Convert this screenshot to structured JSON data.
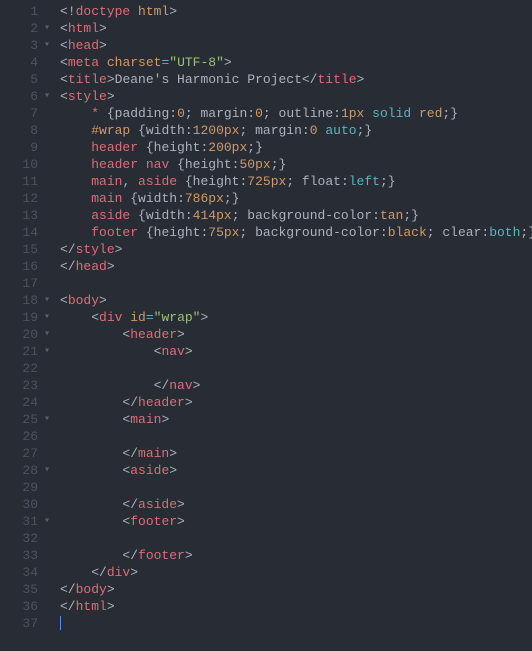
{
  "filename_hint": "index.html",
  "tab_size": 4,
  "lines": [
    {
      "n": 1,
      "fold": "",
      "indent": 0,
      "tokens": [
        [
          "punc",
          "<!"
        ],
        [
          "tag",
          "doctype"
        ],
        [
          "punc",
          " "
        ],
        [
          "attr",
          "html"
        ],
        [
          "punc",
          ">"
        ]
      ]
    },
    {
      "n": 2,
      "fold": "▾",
      "indent": 0,
      "tokens": [
        [
          "punc",
          "<"
        ],
        [
          "tag",
          "html"
        ],
        [
          "punc",
          ">"
        ]
      ]
    },
    {
      "n": 3,
      "fold": "▾",
      "indent": 0,
      "tokens": [
        [
          "punc",
          "<"
        ],
        [
          "tag",
          "head"
        ],
        [
          "punc",
          ">"
        ]
      ]
    },
    {
      "n": 4,
      "fold": "",
      "indent": 0,
      "tokens": [
        [
          "punc",
          "<"
        ],
        [
          "tag",
          "meta"
        ],
        [
          "punc",
          " "
        ],
        [
          "attr",
          "charset"
        ],
        [
          "op",
          "="
        ],
        [
          "str",
          "\"UTF-8\""
        ],
        [
          "punc",
          ">"
        ]
      ]
    },
    {
      "n": 5,
      "fold": "",
      "indent": 0,
      "tokens": [
        [
          "punc",
          "<"
        ],
        [
          "tag",
          "title"
        ],
        [
          "punc",
          ">"
        ],
        [
          "text",
          "Deane's Harmonic Project"
        ],
        [
          "punc",
          "</"
        ],
        [
          "tag",
          "title"
        ],
        [
          "punc",
          ">"
        ]
      ]
    },
    {
      "n": 6,
      "fold": "▾",
      "indent": 0,
      "tokens": [
        [
          "punc",
          "<"
        ],
        [
          "tag",
          "style"
        ],
        [
          "punc",
          ">"
        ]
      ]
    },
    {
      "n": 7,
      "fold": "",
      "indent": 1,
      "tokens": [
        [
          "selkw",
          "*"
        ],
        [
          "punc",
          " {"
        ],
        [
          "prop",
          "padding"
        ],
        [
          "punc",
          ":"
        ],
        [
          "num",
          "0"
        ],
        [
          "punc",
          "; "
        ],
        [
          "prop",
          "margin"
        ],
        [
          "punc",
          ":"
        ],
        [
          "num",
          "0"
        ],
        [
          "punc",
          "; "
        ],
        [
          "prop",
          "outline"
        ],
        [
          "punc",
          ":"
        ],
        [
          "num",
          "1px"
        ],
        [
          "punc",
          " "
        ],
        [
          "kw",
          "solid"
        ],
        [
          "punc",
          " "
        ],
        [
          "hex",
          "red"
        ],
        [
          "punc",
          ";}"
        ]
      ]
    },
    {
      "n": 8,
      "fold": "",
      "indent": 1,
      "tokens": [
        [
          "sel",
          "#wrap"
        ],
        [
          "punc",
          " {"
        ],
        [
          "prop",
          "width"
        ],
        [
          "punc",
          ":"
        ],
        [
          "num",
          "1200px"
        ],
        [
          "punc",
          "; "
        ],
        [
          "prop",
          "margin"
        ],
        [
          "punc",
          ":"
        ],
        [
          "num",
          "0"
        ],
        [
          "punc",
          " "
        ],
        [
          "kw",
          "auto"
        ],
        [
          "punc",
          ";}"
        ]
      ]
    },
    {
      "n": 9,
      "fold": "",
      "indent": 1,
      "tokens": [
        [
          "selkw",
          "header"
        ],
        [
          "punc",
          " {"
        ],
        [
          "prop",
          "height"
        ],
        [
          "punc",
          ":"
        ],
        [
          "num",
          "200px"
        ],
        [
          "punc",
          ";}"
        ]
      ]
    },
    {
      "n": 10,
      "fold": "",
      "indent": 1,
      "tokens": [
        [
          "selkw",
          "header"
        ],
        [
          "punc",
          " "
        ],
        [
          "selkw",
          "nav"
        ],
        [
          "punc",
          " {"
        ],
        [
          "prop",
          "height"
        ],
        [
          "punc",
          ":"
        ],
        [
          "num",
          "50px"
        ],
        [
          "punc",
          ";}"
        ]
      ]
    },
    {
      "n": 11,
      "fold": "",
      "indent": 1,
      "tokens": [
        [
          "selkw",
          "main"
        ],
        [
          "punc",
          ", "
        ],
        [
          "selkw",
          "aside"
        ],
        [
          "punc",
          " {"
        ],
        [
          "prop",
          "height"
        ],
        [
          "punc",
          ":"
        ],
        [
          "num",
          "725px"
        ],
        [
          "punc",
          "; "
        ],
        [
          "prop",
          "float"
        ],
        [
          "punc",
          ":"
        ],
        [
          "kw",
          "left"
        ],
        [
          "punc",
          ";}"
        ]
      ]
    },
    {
      "n": 12,
      "fold": "",
      "indent": 1,
      "tokens": [
        [
          "selkw",
          "main"
        ],
        [
          "punc",
          " {"
        ],
        [
          "prop",
          "width"
        ],
        [
          "punc",
          ":"
        ],
        [
          "num",
          "786px"
        ],
        [
          "punc",
          ";}"
        ]
      ]
    },
    {
      "n": 13,
      "fold": "",
      "indent": 1,
      "tokens": [
        [
          "selkw",
          "aside"
        ],
        [
          "punc",
          " {"
        ],
        [
          "prop",
          "width"
        ],
        [
          "punc",
          ":"
        ],
        [
          "num",
          "414px"
        ],
        [
          "punc",
          "; "
        ],
        [
          "prop",
          "background-color"
        ],
        [
          "punc",
          ":"
        ],
        [
          "hex",
          "tan"
        ],
        [
          "punc",
          ";}"
        ]
      ]
    },
    {
      "n": 14,
      "fold": "",
      "indent": 1,
      "tokens": [
        [
          "selkw",
          "footer"
        ],
        [
          "punc",
          " {"
        ],
        [
          "prop",
          "height"
        ],
        [
          "punc",
          ":"
        ],
        [
          "num",
          "75px"
        ],
        [
          "punc",
          "; "
        ],
        [
          "prop",
          "background-color"
        ],
        [
          "punc",
          ":"
        ],
        [
          "hex",
          "black"
        ],
        [
          "punc",
          "; "
        ],
        [
          "prop",
          "clear"
        ],
        [
          "punc",
          ":"
        ],
        [
          "kw",
          "both"
        ],
        [
          "punc",
          ";}"
        ]
      ]
    },
    {
      "n": 15,
      "fold": "",
      "indent": 0,
      "tokens": [
        [
          "punc",
          "</"
        ],
        [
          "tag",
          "style"
        ],
        [
          "punc",
          ">"
        ]
      ]
    },
    {
      "n": 16,
      "fold": "",
      "indent": 0,
      "tokens": [
        [
          "punc",
          "</"
        ],
        [
          "tag",
          "head"
        ],
        [
          "punc",
          ">"
        ]
      ]
    },
    {
      "n": 17,
      "fold": "",
      "indent": 0,
      "tokens": []
    },
    {
      "n": 18,
      "fold": "▾",
      "indent": 0,
      "tokens": [
        [
          "punc",
          "<"
        ],
        [
          "tag",
          "body"
        ],
        [
          "punc",
          ">"
        ]
      ]
    },
    {
      "n": 19,
      "fold": "▾",
      "indent": 1,
      "tokens": [
        [
          "punc",
          "<"
        ],
        [
          "tag",
          "div"
        ],
        [
          "punc",
          " "
        ],
        [
          "attr",
          "id"
        ],
        [
          "op",
          "="
        ],
        [
          "str",
          "\"wrap\""
        ],
        [
          "punc",
          ">"
        ]
      ]
    },
    {
      "n": 20,
      "fold": "▾",
      "indent": 2,
      "tokens": [
        [
          "punc",
          "<"
        ],
        [
          "tag",
          "header"
        ],
        [
          "punc",
          ">"
        ]
      ]
    },
    {
      "n": 21,
      "fold": "▾",
      "indent": 3,
      "tokens": [
        [
          "punc",
          "<"
        ],
        [
          "tag",
          "nav"
        ],
        [
          "punc",
          ">"
        ]
      ]
    },
    {
      "n": 22,
      "fold": "",
      "indent": 4,
      "tokens": []
    },
    {
      "n": 23,
      "fold": "",
      "indent": 3,
      "tokens": [
        [
          "punc",
          "</"
        ],
        [
          "tag",
          "nav"
        ],
        [
          "punc",
          ">"
        ]
      ]
    },
    {
      "n": 24,
      "fold": "",
      "indent": 2,
      "tokens": [
        [
          "punc",
          "</"
        ],
        [
          "tag",
          "header"
        ],
        [
          "punc",
          ">"
        ]
      ]
    },
    {
      "n": 25,
      "fold": "▾",
      "indent": 2,
      "tokens": [
        [
          "punc",
          "<"
        ],
        [
          "tag",
          "main"
        ],
        [
          "punc",
          ">"
        ]
      ]
    },
    {
      "n": 26,
      "fold": "",
      "indent": 3,
      "tokens": []
    },
    {
      "n": 27,
      "fold": "",
      "indent": 2,
      "tokens": [
        [
          "punc",
          "</"
        ],
        [
          "tag",
          "main"
        ],
        [
          "punc",
          ">"
        ]
      ]
    },
    {
      "n": 28,
      "fold": "▾",
      "indent": 2,
      "tokens": [
        [
          "punc",
          "<"
        ],
        [
          "tag",
          "aside"
        ],
        [
          "punc",
          ">"
        ]
      ]
    },
    {
      "n": 29,
      "fold": "",
      "indent": 3,
      "tokens": []
    },
    {
      "n": 30,
      "fold": "",
      "indent": 2,
      "tokens": [
        [
          "punc",
          "</"
        ],
        [
          "tag",
          "aside"
        ],
        [
          "punc",
          ">"
        ]
      ]
    },
    {
      "n": 31,
      "fold": "▾",
      "indent": 2,
      "tokens": [
        [
          "punc",
          "<"
        ],
        [
          "tag",
          "footer"
        ],
        [
          "punc",
          ">"
        ]
      ]
    },
    {
      "n": 32,
      "fold": "",
      "indent": 3,
      "tokens": []
    },
    {
      "n": 33,
      "fold": "",
      "indent": 2,
      "tokens": [
        [
          "punc",
          "</"
        ],
        [
          "tag",
          "footer"
        ],
        [
          "punc",
          ">"
        ]
      ]
    },
    {
      "n": 34,
      "fold": "",
      "indent": 1,
      "tokens": [
        [
          "punc",
          "</"
        ],
        [
          "tag",
          "div"
        ],
        [
          "punc",
          ">"
        ]
      ]
    },
    {
      "n": 35,
      "fold": "",
      "indent": 0,
      "tokens": [
        [
          "punc",
          "</"
        ],
        [
          "tag",
          "body"
        ],
        [
          "punc",
          ">"
        ]
      ]
    },
    {
      "n": 36,
      "fold": "",
      "indent": 0,
      "tokens": [
        [
          "punc",
          "</"
        ],
        [
          "tag",
          "html"
        ],
        [
          "punc",
          ">"
        ]
      ]
    },
    {
      "n": 37,
      "fold": "",
      "indent": 0,
      "tokens": [],
      "cursor": true
    }
  ]
}
